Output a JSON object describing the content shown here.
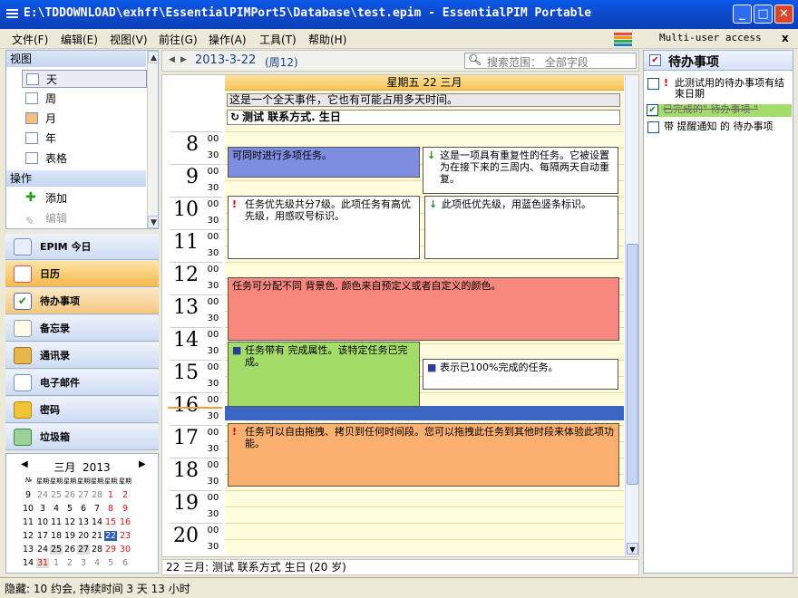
{
  "window": {
    "title": "E:\\TDDOWNLOAD\\exhff\\EssentialPIMPort5\\Database\\test.epim - EssentialPIM Portable"
  },
  "menu": {
    "items": [
      "文件(F)",
      "编辑(E)",
      "视图(V)",
      "前往(G)",
      "操作(A)",
      "工具(T)",
      "帮助(H)"
    ],
    "multi_user": "Multi-user access",
    "close_x": "x"
  },
  "left_panel": {
    "view_header": "视图",
    "views": [
      "天",
      "周",
      "月",
      "年",
      "表格"
    ],
    "actions_header": "操作",
    "actions": [
      "添加",
      "编辑"
    ]
  },
  "modules": [
    "EPIM 今日",
    "日历",
    "待办事项",
    "备忘录",
    "通讯录",
    "电子邮件",
    "密码",
    "垃圾箱"
  ],
  "mini_calendar": {
    "month": "三月",
    "year": "2013",
    "week_header": [
      "№",
      "星期一",
      "星期二",
      "星期三",
      "星期四",
      "星期五",
      "星期六",
      "星期日"
    ],
    "weeks": [
      {
        "no": "9",
        "days": [
          "24",
          "25",
          "26",
          "27",
          "28",
          "1",
          "2"
        ]
      },
      {
        "no": "10",
        "days": [
          "3",
          "4",
          "5",
          "6",
          "7",
          "8",
          "9"
        ]
      },
      {
        "no": "11",
        "days": [
          "10",
          "11",
          "12",
          "13",
          "14",
          "15",
          "16"
        ]
      },
      {
        "no": "12",
        "days": [
          "17",
          "18",
          "19",
          "20",
          "21",
          "22",
          "23"
        ]
      },
      {
        "no": "13",
        "days": [
          "24",
          "25",
          "26",
          "27",
          "28",
          "29",
          "30"
        ]
      },
      {
        "no": "14",
        "days": [
          "31",
          "1",
          "2",
          "3",
          "4",
          "5",
          "6"
        ]
      }
    ],
    "selected": "22",
    "accent": "#2d5bb8"
  },
  "date_bar": {
    "date": "2013-3-22",
    "weekday": "(周12)",
    "search_placeholder": "搜索范围：  全部字段"
  },
  "day_view": {
    "header": "星期五 22 三月",
    "all_day_events": [
      "这是一个全天事件，它也有可能占用多天时间。",
      "测试 联系方式. 生日"
    ],
    "hours": [
      "8",
      "9",
      "10",
      "11",
      "12",
      "13",
      "14",
      "15",
      "16",
      "17",
      "18",
      "19",
      "20"
    ],
    "minutes": [
      "00",
      "30"
    ],
    "events": [
      {
        "text": "可同时进行多项任务。",
        "color": "#7f8de0",
        "marker": ""
      },
      {
        "text": "这是一项具有重复性的任务。它被设置为在接下来的三周内、每隔两天自动重复。",
        "color": "#ffffff",
        "marker": "↓"
      },
      {
        "text": "任务优先级共分7级。此项任务有高优先级，用感叹号标识。",
        "color": "#ffffff",
        "marker": "!"
      },
      {
        "text": "此项低优先级，用蓝色竖条标识。",
        "color": "#ffffff",
        "marker": "↓"
      },
      {
        "text": "任务可分配不同 背景色, 颜色来自预定义或者自定义的颜色。",
        "color": "#f8877e",
        "marker": ""
      },
      {
        "text": "任务带有 完成属性。该特定任务已完成。",
        "color": "#a4dc6a",
        "marker": "■"
      },
      {
        "text": "表示已100%完成的任务。",
        "color": "#ffffff",
        "marker": "■"
      },
      {
        "text": "任务可以自由拖拽、拷贝到任何时间段。您可以拖拽此任务到其他时段来体验此项功能。",
        "color": "#fbb070",
        "marker": "!"
      }
    ],
    "footer": "22 三月:  测试 联系方式 生日  (20 岁)"
  },
  "todo": {
    "title": "待办事项",
    "items": [
      {
        "text": "此测试用的待办事项有结束日期",
        "done": false,
        "marker": "!"
      },
      {
        "text": "已完成的\" 待办事项 \"",
        "done": true,
        "marker": ""
      },
      {
        "text": "带 提醒通知 的 待办事项",
        "done": false,
        "marker": ""
      }
    ]
  },
  "status": {
    "text": "隐藏: 10 约会, 持续时间 3 天 13 小时"
  }
}
